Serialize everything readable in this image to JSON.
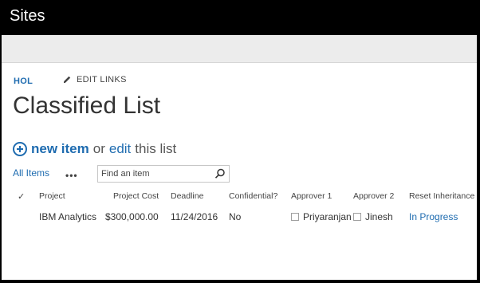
{
  "topbar": {
    "title": "Sites"
  },
  "breadcrumb": {
    "site": "HOL",
    "edit_links": "EDIT LINKS"
  },
  "page": {
    "title": "Classified List"
  },
  "actions": {
    "new_item": "new item",
    "or": "or",
    "edit": "edit",
    "this_list": "this list"
  },
  "views": {
    "all_items": "All Items",
    "more": "•••"
  },
  "search": {
    "placeholder": "Find an item"
  },
  "table": {
    "headers": {
      "check": "✓",
      "project": "Project",
      "project_cost": "Project Cost",
      "deadline": "Deadline",
      "confidential": "Confidential?",
      "approver1": "Approver 1",
      "approver2": "Approver 2",
      "reset_inheritance": "Reset Inheritance"
    },
    "rows": [
      {
        "project": "IBM Analytics",
        "project_cost": "$300,000.00",
        "deadline": "11/24/2016",
        "confidential": "No",
        "approver1": "Priyaranjan",
        "approver2": "Jinesh",
        "reset_inheritance": "In Progress"
      }
    ]
  },
  "colors": {
    "accent": "#1f6cb0",
    "topbar": "#000000",
    "ribbon": "#ececec"
  }
}
